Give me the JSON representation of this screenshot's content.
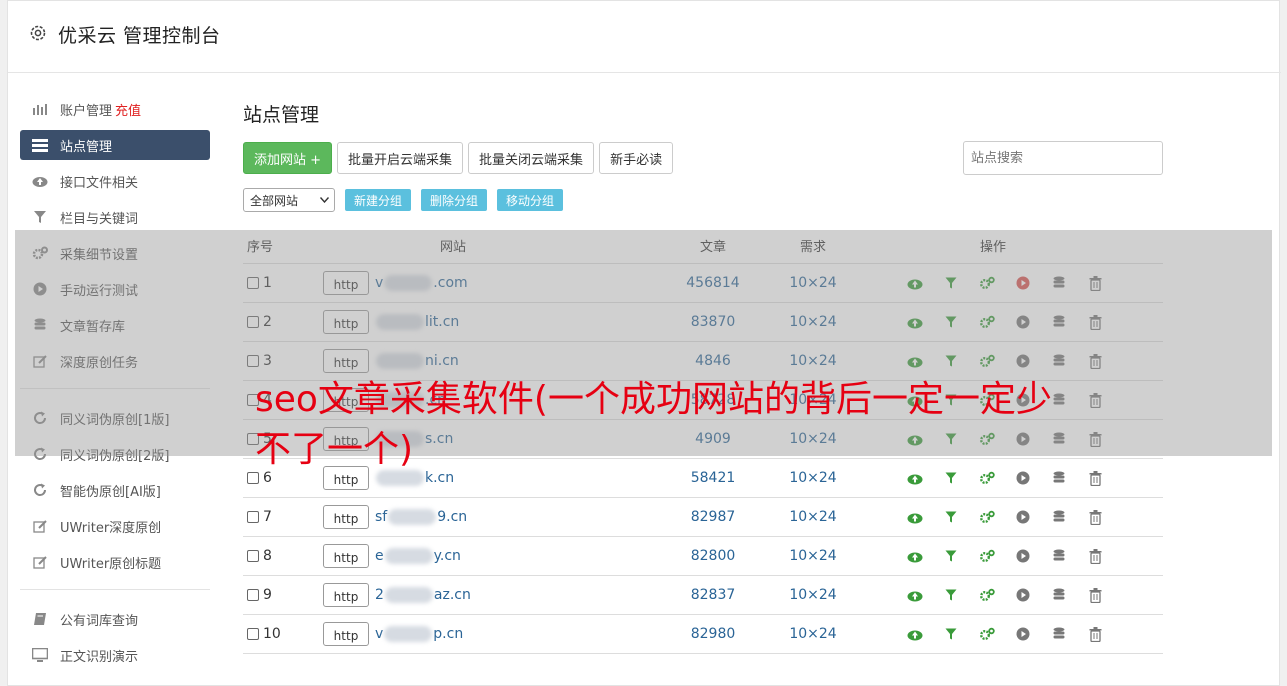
{
  "header": {
    "title": "优采云 管理控制台",
    "icon": "gear-icon"
  },
  "sidebar": {
    "group1": [
      {
        "label": "账户管理",
        "extra": "充值",
        "icon": "bar-chart-icon",
        "active": false
      },
      {
        "label": "站点管理",
        "icon": "server-icon",
        "active": true
      },
      {
        "label": "接口文件相关",
        "icon": "cloud-upload-icon",
        "active": false
      },
      {
        "label": "栏目与关键词",
        "icon": "filter-icon",
        "active": false
      },
      {
        "label": "采集细节设置",
        "icon": "cogs-icon",
        "active": false
      },
      {
        "label": "手动运行测试",
        "icon": "play-circle-icon",
        "active": false
      },
      {
        "label": "文章暂存库",
        "icon": "database-icon",
        "active": false
      },
      {
        "label": "深度原创任务",
        "icon": "edit-icon",
        "active": false
      }
    ],
    "group2": [
      {
        "label": "同义词伪原创[1版]",
        "icon": "refresh-icon"
      },
      {
        "label": "同义词伪原创[2版]",
        "icon": "refresh-icon"
      },
      {
        "label": "智能伪原创[AI版]",
        "icon": "refresh-icon"
      },
      {
        "label": "UWriter深度原创",
        "icon": "edit-icon"
      },
      {
        "label": "UWriter原创标题",
        "icon": "edit-icon"
      }
    ],
    "group3": [
      {
        "label": "公有词库查询",
        "icon": "book-icon"
      },
      {
        "label": "正文识别演示",
        "icon": "monitor-icon"
      }
    ]
  },
  "main": {
    "title": "站点管理",
    "buttons": {
      "add": "添加网站 +",
      "enable": "批量开启云端采集",
      "disable": "批量关闭云端采集",
      "guide": "新手必读"
    },
    "search_placeholder": "站点搜索",
    "group_select": "全部网站",
    "group_buttons": {
      "new": "新建分组",
      "delete": "删除分组",
      "move": "移动分组"
    }
  },
  "table": {
    "headers": {
      "no": "序号",
      "site": "网站",
      "articles": "文章",
      "demand": "需求",
      "ops": "操作"
    },
    "http_label": "http",
    "rows": [
      {
        "no": "1",
        "pre": "v",
        "post": ".com",
        "articles": "456814",
        "demand": "10×24",
        "active": true
      },
      {
        "no": "2",
        "pre": "",
        "post": "lit.cn",
        "articles": "83870",
        "demand": "10×24",
        "active": false
      },
      {
        "no": "3",
        "pre": "",
        "post": "ni.cn",
        "articles": "4846",
        "demand": "10×24",
        "active": false
      },
      {
        "no": "4",
        "pre": "",
        "post": ".cn",
        "articles": "58728",
        "demand": "10×24",
        "active": false
      },
      {
        "no": "5",
        "pre": "",
        "post": "s.cn",
        "articles": "4909",
        "demand": "10×24",
        "active": false
      },
      {
        "no": "6",
        "pre": "",
        "post": "k.cn",
        "articles": "58421",
        "demand": "10×24",
        "active": false
      },
      {
        "no": "7",
        "pre": "sf",
        "post": "9.cn",
        "articles": "82987",
        "demand": "10×24",
        "active": false
      },
      {
        "no": "8",
        "pre": "e",
        "post": "y.cn",
        "articles": "82800",
        "demand": "10×24",
        "active": false
      },
      {
        "no": "9",
        "pre": "2",
        "post": "az.cn",
        "articles": "82837",
        "demand": "10×24",
        "active": false
      },
      {
        "no": "10",
        "pre": "v",
        "post": "p.cn",
        "articles": "82980",
        "demand": "10×24",
        "active": false
      }
    ]
  },
  "overlay": {
    "headline": "seo文章采集软件(一个成功网站的背后一定一定少不了一个)"
  },
  "colors": {
    "green": "#5cb85c",
    "sidebar_active": "#3b4f6b",
    "accent_blue": "#5bc0de",
    "headline_red": "#e60012",
    "play_red": "#d9534f"
  }
}
